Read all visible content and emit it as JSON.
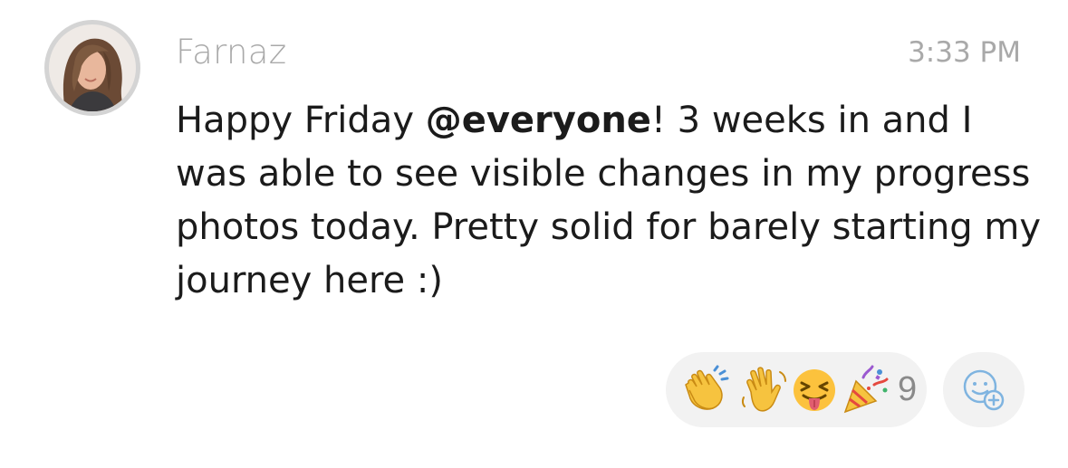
{
  "message": {
    "author": "Farnaz",
    "time": "3:33 PM",
    "text_before_mention": "Happy Friday ",
    "mention": "@everyone",
    "text_after_mention": "! 3 weeks in and I was able to see visible changes in my progress photos today. Pretty solid for barely starting my journey here :)"
  },
  "reactions": {
    "emojis": [
      "clapping-hands",
      "waving-hand",
      "squinting-face-with-tongue",
      "party-popper"
    ],
    "count": "9"
  },
  "icons": {
    "add_reaction": "add-reaction-smiley-icon"
  },
  "colors": {
    "meta_text": "#a9a9a9",
    "body_text": "#1b1b1b",
    "pill_bg": "#f2f2f2",
    "emoji_yellow": "#fcc23d",
    "add_icon": "#7fb4e0"
  }
}
